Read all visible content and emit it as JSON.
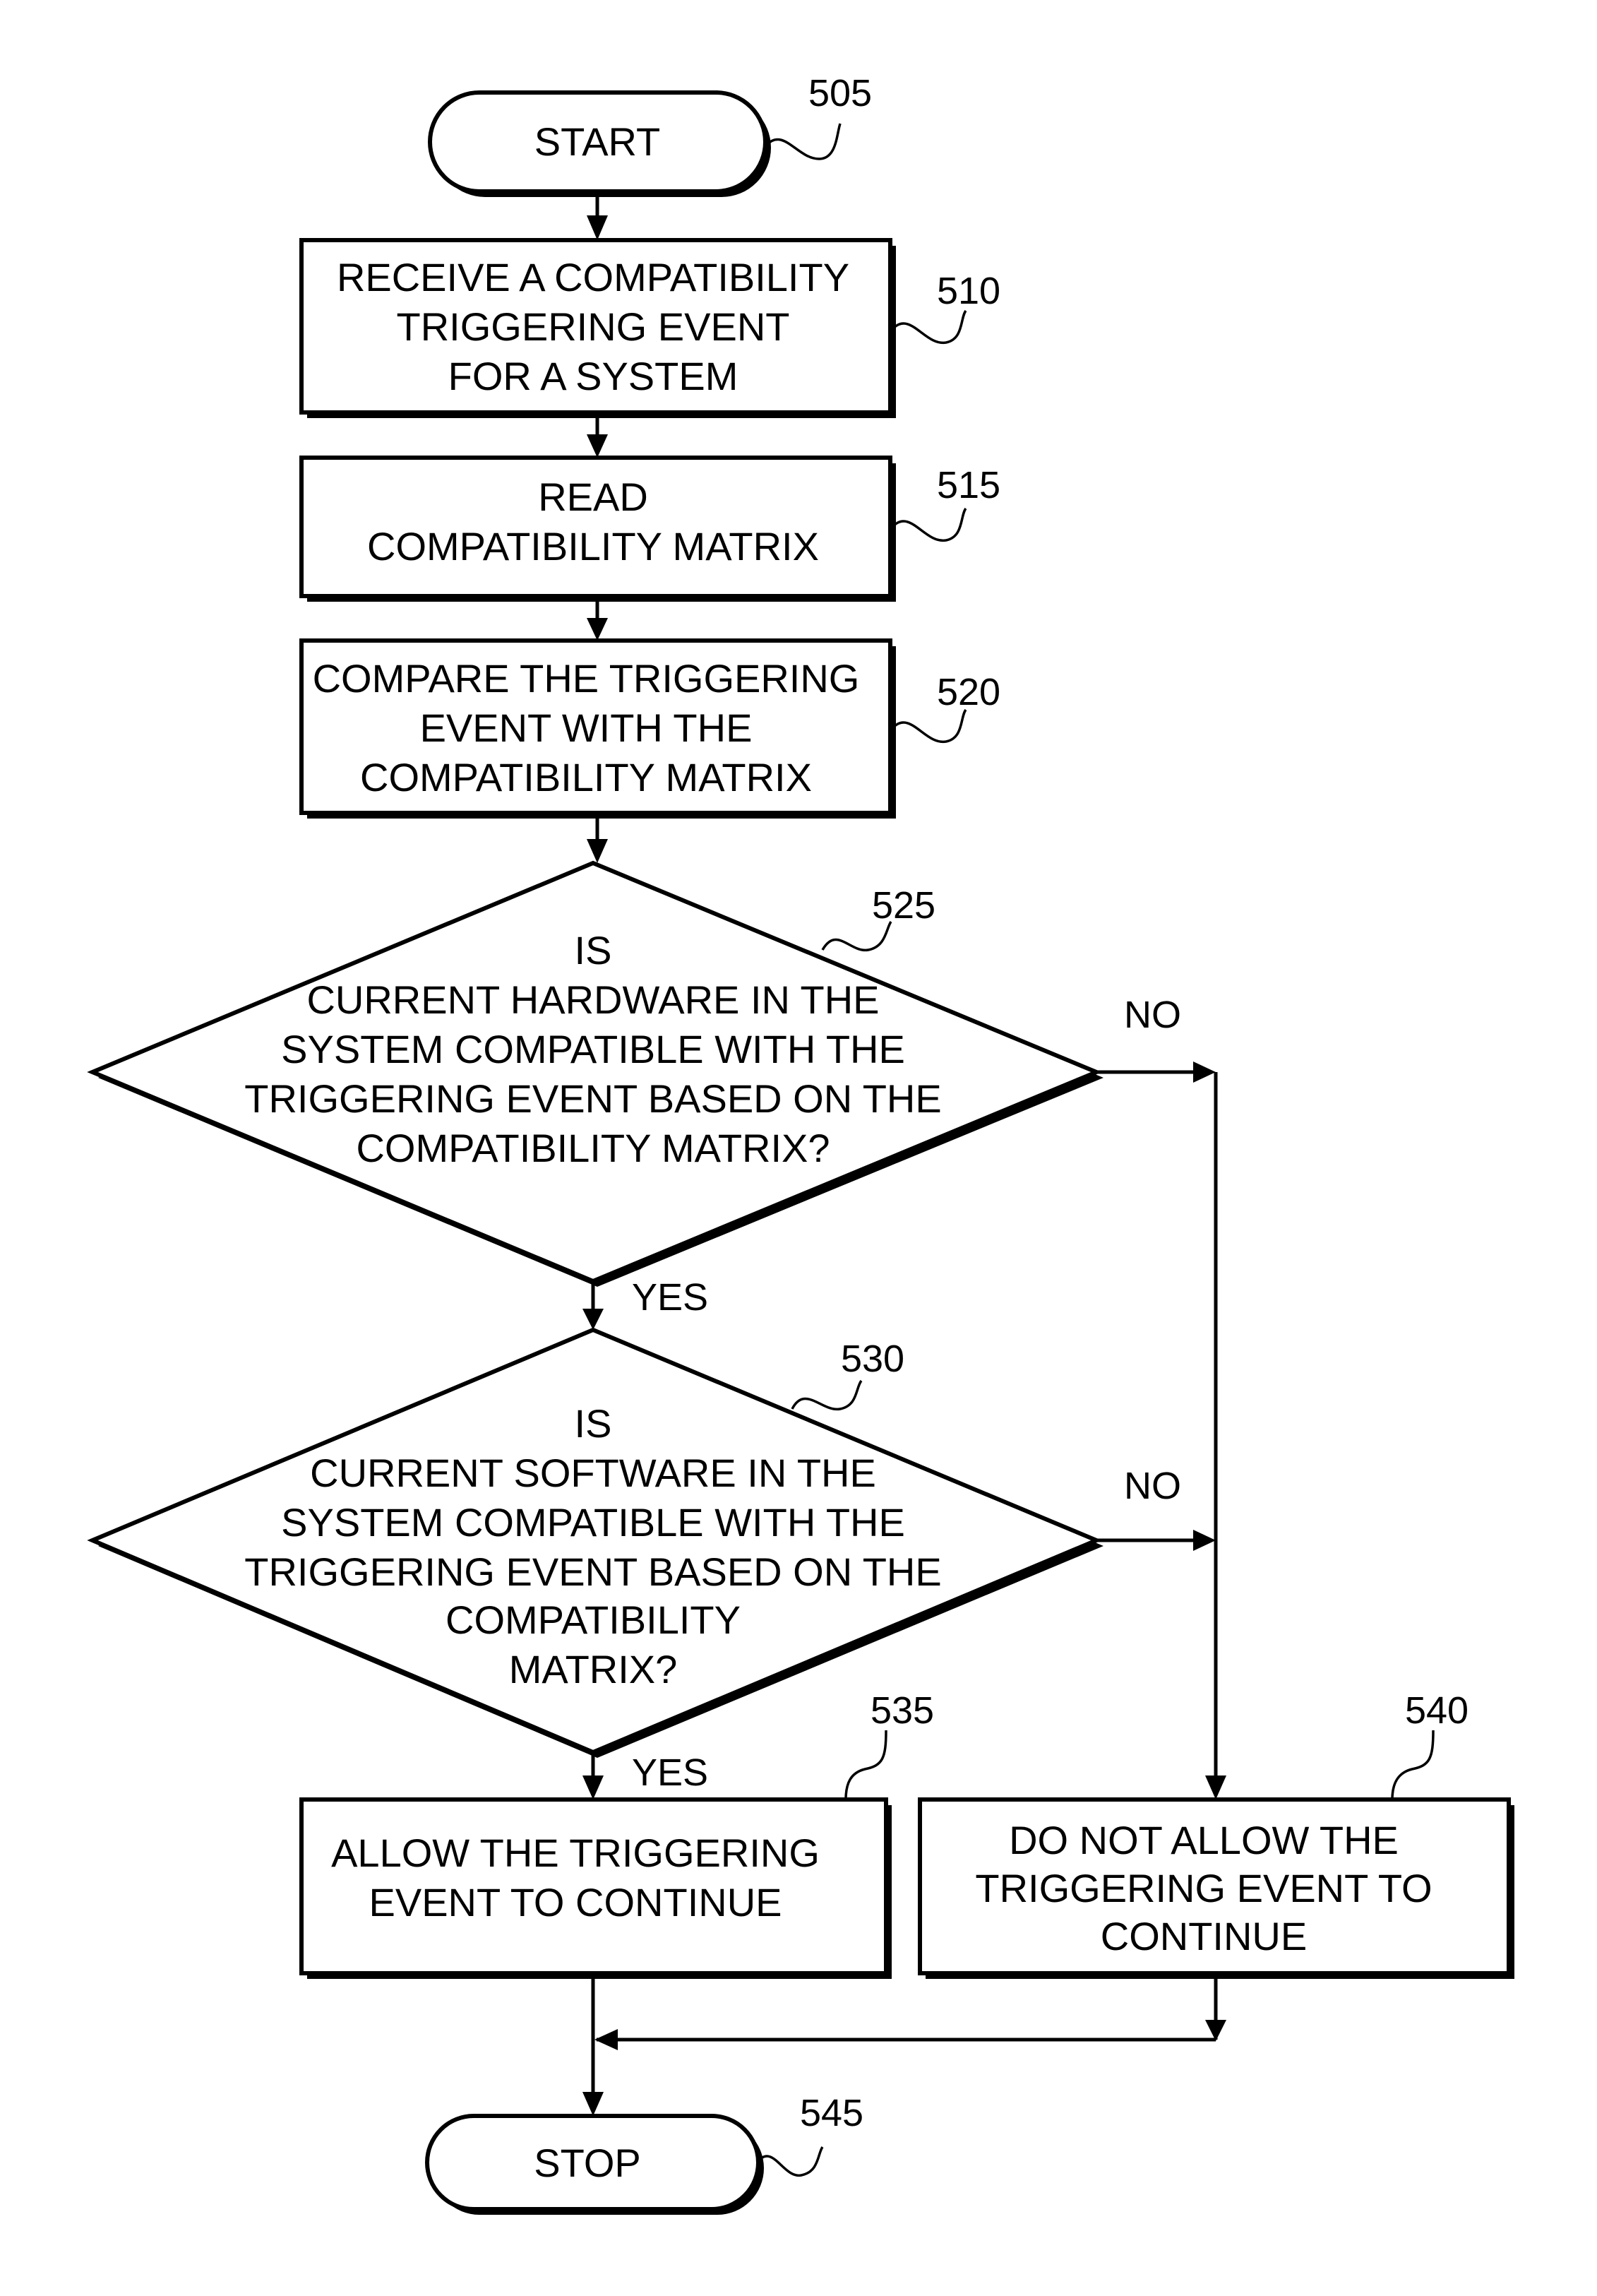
{
  "flowchart": {
    "nodes": {
      "start": {
        "ref": "505",
        "lines": [
          "START"
        ]
      },
      "receive": {
        "ref": "510",
        "lines": [
          "RECEIVE A COMPATIBILITY",
          "TRIGGERING EVENT",
          "FOR A SYSTEM"
        ]
      },
      "read": {
        "ref": "515",
        "lines": [
          "READ",
          "COMPATIBILITY MATRIX"
        ]
      },
      "compare": {
        "ref": "520",
        "lines": [
          "COMPARE THE TRIGGERING",
          "EVENT WITH THE",
          "COMPATIBILITY MATRIX"
        ]
      },
      "hardware_check": {
        "ref": "525",
        "lines": [
          "IS",
          "CURRENT HARDWARE IN THE",
          "SYSTEM COMPATIBLE WITH THE",
          "TRIGGERING EVENT BASED ON THE",
          "COMPATIBILITY MATRIX?"
        ]
      },
      "software_check": {
        "ref": "530",
        "lines": [
          "IS",
          "CURRENT SOFTWARE IN THE",
          "SYSTEM COMPATIBLE WITH THE",
          "TRIGGERING EVENT BASED ON THE",
          "COMPATIBILITY",
          "MATRIX?"
        ]
      },
      "allow": {
        "ref": "535",
        "lines": [
          "ALLOW THE TRIGGERING",
          "EVENT TO CONTINUE"
        ]
      },
      "deny": {
        "ref": "540",
        "lines": [
          "DO NOT ALLOW THE",
          "TRIGGERING EVENT TO",
          "CONTINUE"
        ]
      },
      "stop": {
        "ref": "545",
        "lines": [
          "STOP"
        ]
      }
    },
    "branches": {
      "hardware_no": "NO",
      "hardware_yes": "YES",
      "software_no": "NO",
      "software_yes": "YES"
    }
  }
}
